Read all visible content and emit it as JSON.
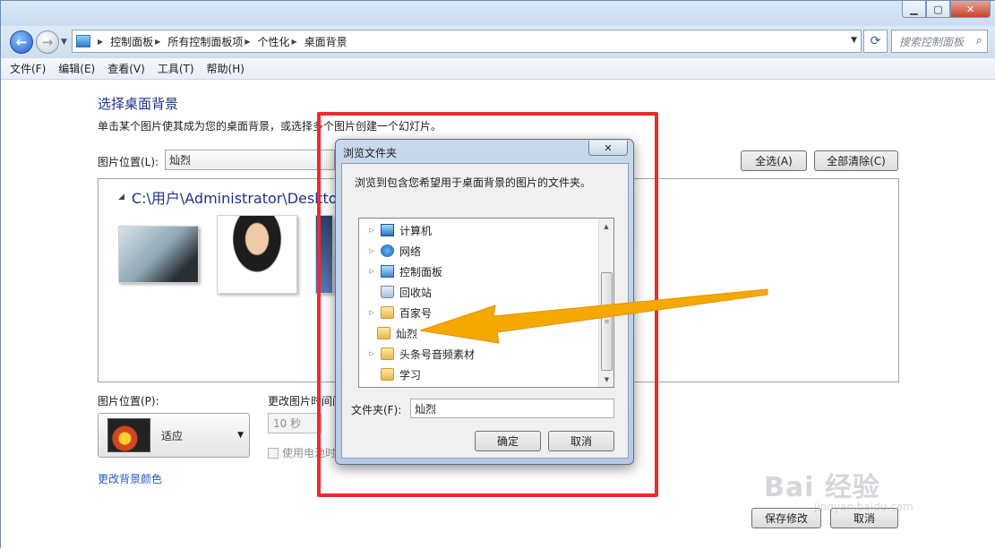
{
  "nav": {
    "breadcrumbs": [
      "控制面板",
      "所有控制面板项",
      "个性化",
      "桌面背景"
    ],
    "search_placeholder": "搜索控制面板"
  },
  "menu": [
    "文件(F)",
    "编辑(E)",
    "查看(V)",
    "工具(T)",
    "帮助(H)"
  ],
  "page": {
    "title": "选择桌面背景",
    "subtitle": "单击某个图片使其成为您的桌面背景，或选择多个图片创建一个幻灯片。",
    "location_label": "图片位置(L):",
    "location_value": "灿烈",
    "select_all": "全选(A)",
    "clear_all": "全部清除(C)",
    "gallery_path": "C:\\用户\\Administrator\\Desktop\\灿",
    "position_label": "图片位置(P):",
    "position_value": "适应",
    "interval_label": "更改图片时间间",
    "interval_value": "10 秒",
    "battery_label": "使用电池时",
    "change_color_link": "更改背景颜色",
    "save_button": "保存修改",
    "cancel_button": "取消"
  },
  "dialog": {
    "title": "浏览文件夹",
    "description": "浏览到包含您希望用于桌面背景的图片的文件夹。",
    "tree": [
      {
        "label": "计算机",
        "icon": "computer-icon",
        "expandable": true
      },
      {
        "label": "网络",
        "icon": "network-icon",
        "expandable": true
      },
      {
        "label": "控制面板",
        "icon": "control-panel-icon",
        "expandable": true
      },
      {
        "label": "回收站",
        "icon": "recycle-bin-icon",
        "expandable": false
      },
      {
        "label": "百家号",
        "icon": "folder-icon",
        "expandable": true
      },
      {
        "label": "灿烈",
        "icon": "folder-icon",
        "expandable": false,
        "selected": true
      },
      {
        "label": "头条号音频素材",
        "icon": "folder-icon",
        "expandable": true
      },
      {
        "label": "学习",
        "icon": "folder-icon",
        "expandable": false
      }
    ],
    "folder_label": "文件夹(F):",
    "folder_value": "灿烈",
    "ok_button": "确定",
    "cancel_button": "取消"
  },
  "annotations": {
    "highlight_color": "#ef2b2b",
    "arrow_color": "#f5a800"
  },
  "watermark": {
    "brand": "Bai 经验",
    "url": "jingyan.baidu.com"
  }
}
